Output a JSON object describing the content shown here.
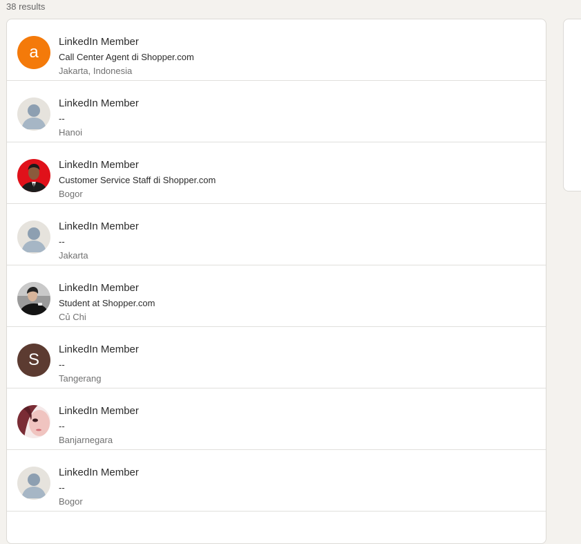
{
  "results_count": "38 results",
  "colors": {
    "orange_avatar": "#f47a0a",
    "brown_avatar": "#5c3b31",
    "placeholder_bg": "#e6e3dd",
    "placeholder_figure": "#8d9fb1",
    "red_photo_bg": "#e0111a"
  },
  "people": [
    {
      "name": "LinkedIn Member",
      "headline": "Call Center Agent di Shopper.com",
      "location": "Jakarta, Indonesia",
      "avatar": "letter",
      "avatar_letter": "a"
    },
    {
      "name": "LinkedIn Member",
      "headline": "--",
      "location": "Hanoi",
      "avatar": "placeholder-person-icon"
    },
    {
      "name": "LinkedIn Member",
      "headline": "Customer Service Staff di Shopper.com",
      "location": "Bogor",
      "avatar": "photo"
    },
    {
      "name": "LinkedIn Member",
      "headline": "--",
      "location": "Jakarta",
      "avatar": "placeholder-person-icon"
    },
    {
      "name": "LinkedIn Member",
      "headline": "Student at Shopper.com",
      "location": "Củ Chi",
      "avatar": "photo"
    },
    {
      "name": "LinkedIn Member",
      "headline": "--",
      "location": "Tangerang",
      "avatar": "letter",
      "avatar_letter": "S"
    },
    {
      "name": "LinkedIn Member",
      "headline": "--",
      "location": "Banjarnegara",
      "avatar": "photo"
    },
    {
      "name": "LinkedIn Member",
      "headline": "--",
      "location": "Bogor",
      "avatar": "placeholder-person-icon"
    }
  ]
}
